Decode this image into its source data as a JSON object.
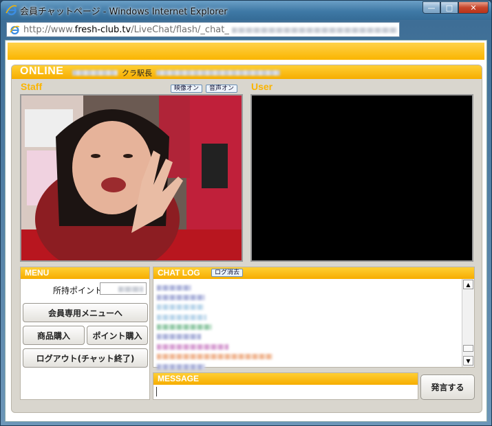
{
  "window": {
    "title": "会員チャットページ - Windows Internet Explorer",
    "controls": {
      "minimize": "—",
      "maximize": "□",
      "close": "✕"
    }
  },
  "address": {
    "prefix": "http://www.",
    "host": "fresh-club.tv",
    "path": "/LiveChat/flash/_chat_"
  },
  "online": {
    "label": "ONLINE",
    "text": "クラ駅長"
  },
  "staff": {
    "title": "Staff",
    "video_on": "映像オン",
    "audio_on": "音声オン"
  },
  "user": {
    "title": "User"
  },
  "menu": {
    "title": "MENU",
    "points_label": "所持ポイント",
    "member_menu": "会員専用メニューへ",
    "buy_product": "商品購入",
    "buy_points": "ポイント購入",
    "logout": "ログアウト(チャット終了)"
  },
  "chat": {
    "title": "CHAT LOG",
    "clear_log": "ログ消去",
    "scroll_up": "▲",
    "scroll_down": "▼"
  },
  "message": {
    "title": "MESSAGE",
    "value": "",
    "send": "発言する"
  },
  "colors": {
    "accent": "#f6ad00",
    "panel": "#d9d6ce"
  }
}
